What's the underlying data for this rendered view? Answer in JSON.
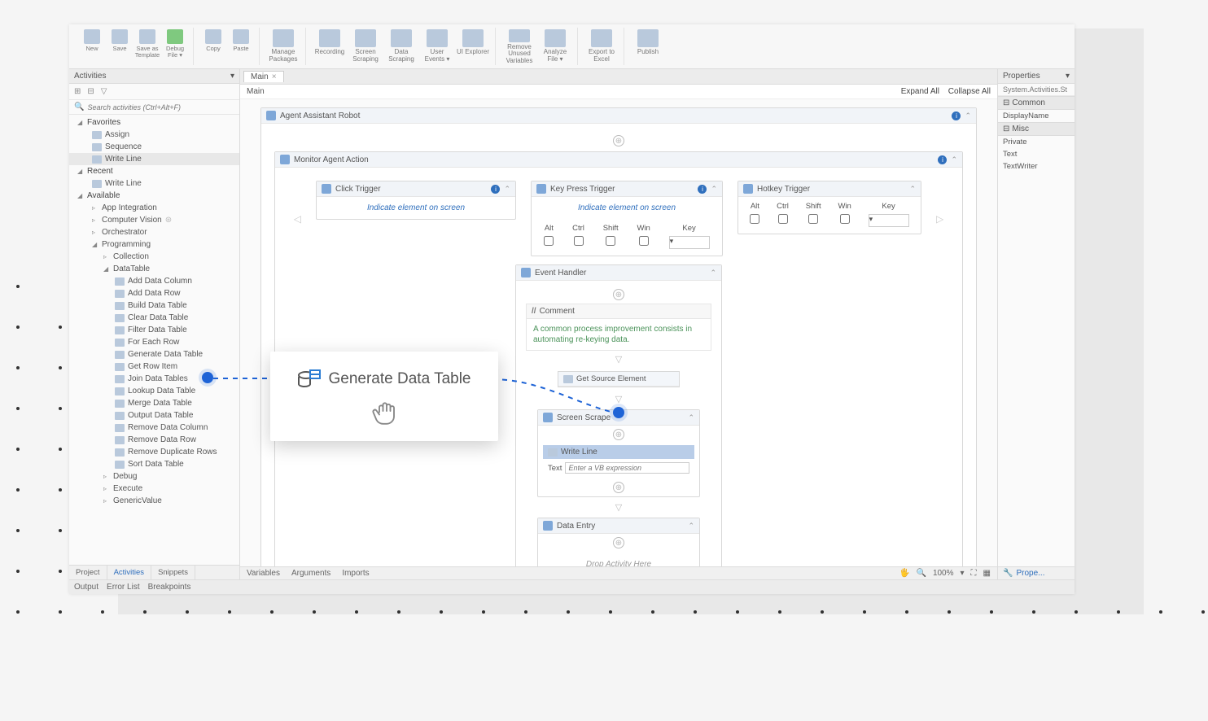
{
  "ribbon": {
    "new": "New",
    "save": "Save",
    "save_as_template": "Save as Template",
    "debug": "Debug File ▾",
    "copy": "Copy",
    "paste": "Paste",
    "manage_packages": "Manage Packages",
    "recording": "Recording",
    "screen_scraping": "Screen Scraping",
    "data_scraping": "Data Scraping",
    "user_events": "User Events ▾",
    "ui_explorer": "UI Explorer",
    "remove_unused": "Remove Unused Variables",
    "analyze_file": "Analyze File ▾",
    "export_excel": "Export to Excel",
    "publish": "Publish"
  },
  "activities": {
    "panel_title": "Activities",
    "search_placeholder": "Search activities (Ctrl+Alt+F)",
    "favorites": "Favorites",
    "fav_items": [
      "Assign",
      "Sequence",
      "Write Line"
    ],
    "recent": "Recent",
    "recent_items": [
      "Write Line"
    ],
    "available": "Available",
    "avail_groups": {
      "app_integration": "App Integration",
      "computer_vision": "Computer Vision",
      "orchestrator": "Orchestrator",
      "programming": "Programming",
      "collection": "Collection",
      "datatable": "DataTable",
      "dt_items": [
        "Add Data Column",
        "Add Data Row",
        "Build Data Table",
        "Clear Data Table",
        "Filter Data Table",
        "For Each Row",
        "Generate Data Table",
        "Get Row Item",
        "Join Data Tables",
        "Lookup Data Table",
        "Merge Data Table",
        "Output Data Table",
        "Remove Data Column",
        "Remove Data Row",
        "Remove Duplicate Rows",
        "Sort Data Table"
      ],
      "debug": "Debug",
      "execute": "Execute",
      "generic_value": "GenericValue"
    },
    "bottom_tabs": {
      "project": "Project",
      "activities": "Activities",
      "snippets": "Snippets"
    }
  },
  "center": {
    "tab": "Main",
    "breadcrumb": "Main",
    "expand_all": "Expand All",
    "collapse_all": "Collapse All",
    "agent_robot": "Agent Assistant Robot",
    "monitor_action": "Monitor Agent Action",
    "click_trigger": "Click Trigger",
    "key_trigger": "Key Press Trigger",
    "hotkey_trigger": "Hotkey Trigger",
    "indicate": "Indicate element on screen",
    "kbd": {
      "alt": "Alt",
      "ctrl": "Ctrl",
      "shift": "Shift",
      "win": "Win",
      "key": "Key"
    },
    "event_handler": "Event Handler",
    "comment": "Comment",
    "comment_text": "A common process improvement consists in automating re-keying data.",
    "get_source": "Get Source Element",
    "screen_scrape": "Screen Scrape",
    "write_line": "Write Line",
    "text_label": "Text",
    "vb_placeholder": "Enter a VB expression",
    "data_entry": "Data Entry",
    "drop_hint": "Drop Activity Here",
    "bottom": {
      "variables": "Variables",
      "arguments": "Arguments",
      "imports": "Imports",
      "zoom": "100%"
    }
  },
  "properties": {
    "title": "Properties",
    "type": "System.Activities.St",
    "common": "Common",
    "display_name": "DisplayName",
    "misc": "Misc",
    "private": "Private",
    "text": "Text",
    "text_writer": "TextWriter",
    "prope": "Prope..."
  },
  "footer": {
    "output": "Output",
    "error_list": "Error List",
    "breakpoints": "Breakpoints"
  },
  "popup": {
    "title": "Generate Data Table"
  }
}
